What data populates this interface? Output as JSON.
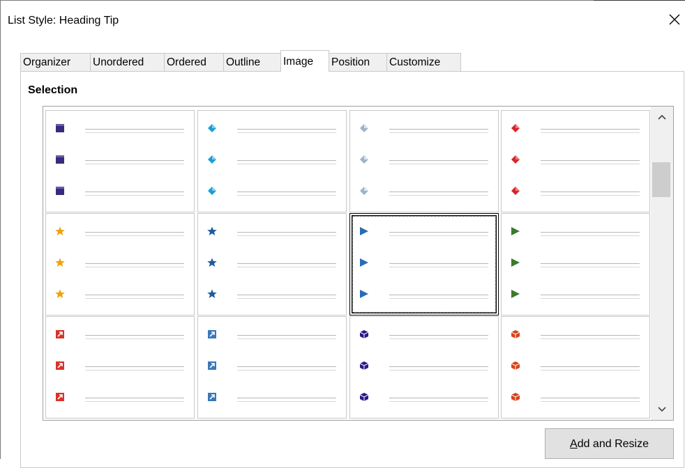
{
  "window": {
    "title": "List Style: Heading Tip"
  },
  "tabs": [
    {
      "label": "Organizer"
    },
    {
      "label": "Unordered"
    },
    {
      "label": "Ordered"
    },
    {
      "label": "Outline"
    },
    {
      "label": "Image"
    },
    {
      "label": "Position"
    },
    {
      "label": "Customize"
    }
  ],
  "active_tab": "Image",
  "section": {
    "title": "Selection"
  },
  "gallery": {
    "rows": [
      [
        "square-purple-bullet",
        "diamond-cyan-bullet",
        "diamond-gray-bullet",
        "diamond-red-bullet"
      ],
      [
        "star-orange-bullet",
        "star-blue-bullet",
        "triangle-blue-bullet",
        "triangle-green-bullet"
      ],
      [
        "arrow-box-red-bullet",
        "arrow-box-blue-bullet",
        "cube-purple-bullet",
        "cube-red-bullet"
      ]
    ],
    "selected": "triangle-blue-bullet"
  },
  "colors": {
    "square-purple": "#3b2a7a",
    "diamond-cyan": "#1a9fd8",
    "diamond-gray": "#9fb3c8",
    "diamond-red": "#d8232a",
    "star-orange": "#f2a20c",
    "star-blue": "#1d5c9e",
    "triangle-blue": "#2a6bb8",
    "triangle-green": "#3b7a2a",
    "arrow-red": "#d8332a",
    "arrow-blue": "#3a78b8",
    "cube-purple": "#2a1a8a",
    "cube-red": "#d8421a"
  },
  "buttons": {
    "add_resize": "Add and Resize"
  }
}
